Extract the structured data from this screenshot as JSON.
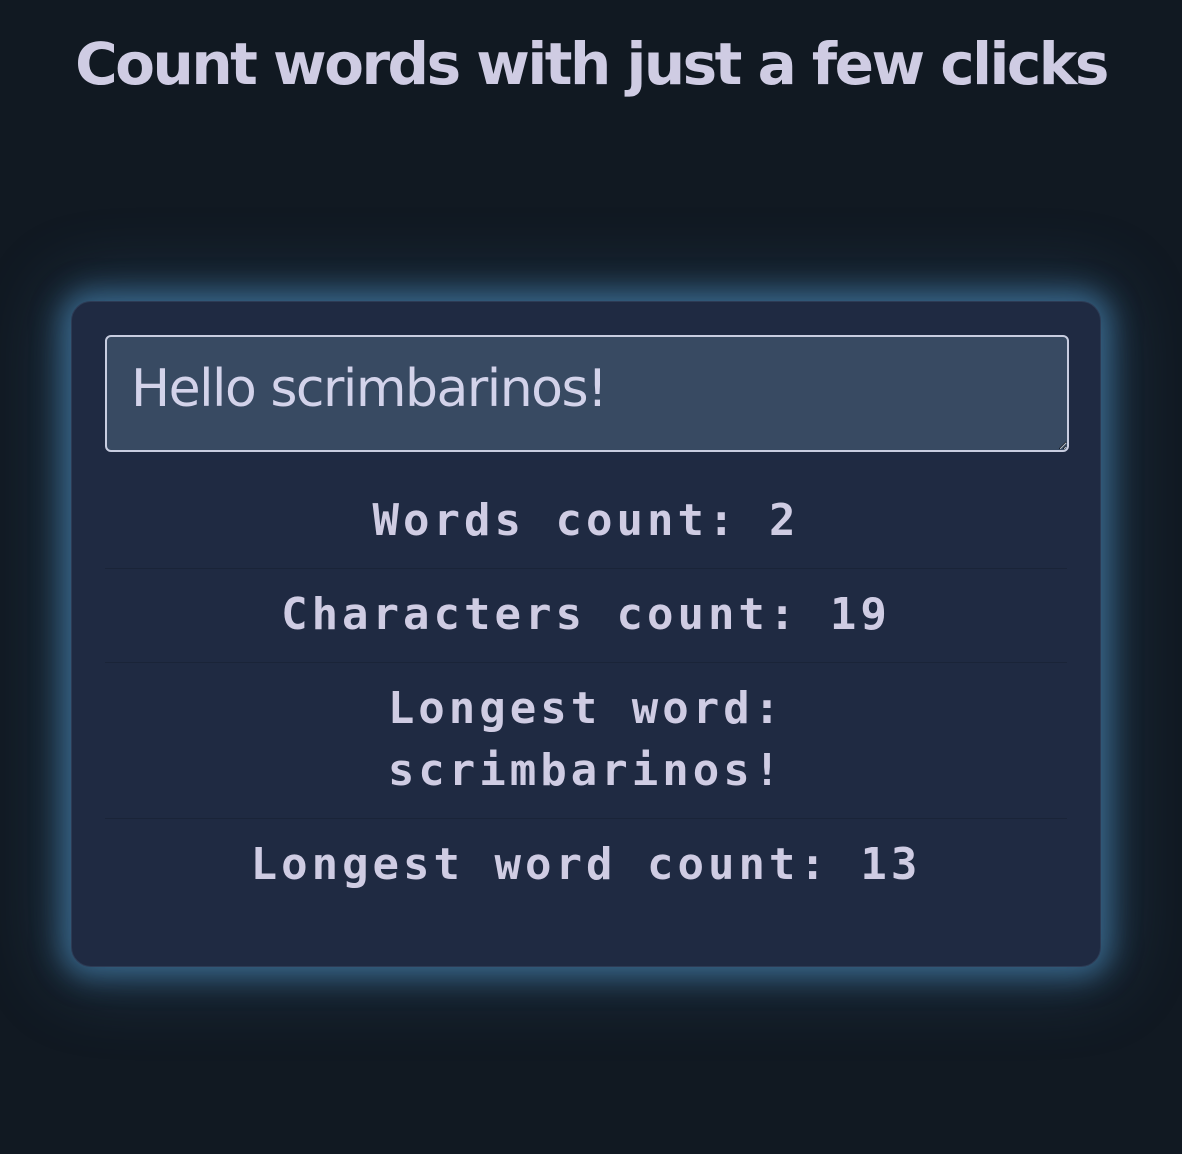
{
  "header": {
    "title": "Count words with just a few clicks"
  },
  "input": {
    "value": "Hello scrimbarinos!"
  },
  "stats": [
    {
      "label": "Words count:",
      "value": "2"
    },
    {
      "label": "Characters count:",
      "value": "19"
    },
    {
      "label": "Longest word:",
      "value": "scrimbarinos!"
    },
    {
      "label": "Longest word count:",
      "value": "13"
    }
  ],
  "colors": {
    "background": "#111922",
    "card": "#1f2a42",
    "input_background": "#384a62",
    "text": "#cfcce3",
    "glow": "#4a8fc0"
  }
}
